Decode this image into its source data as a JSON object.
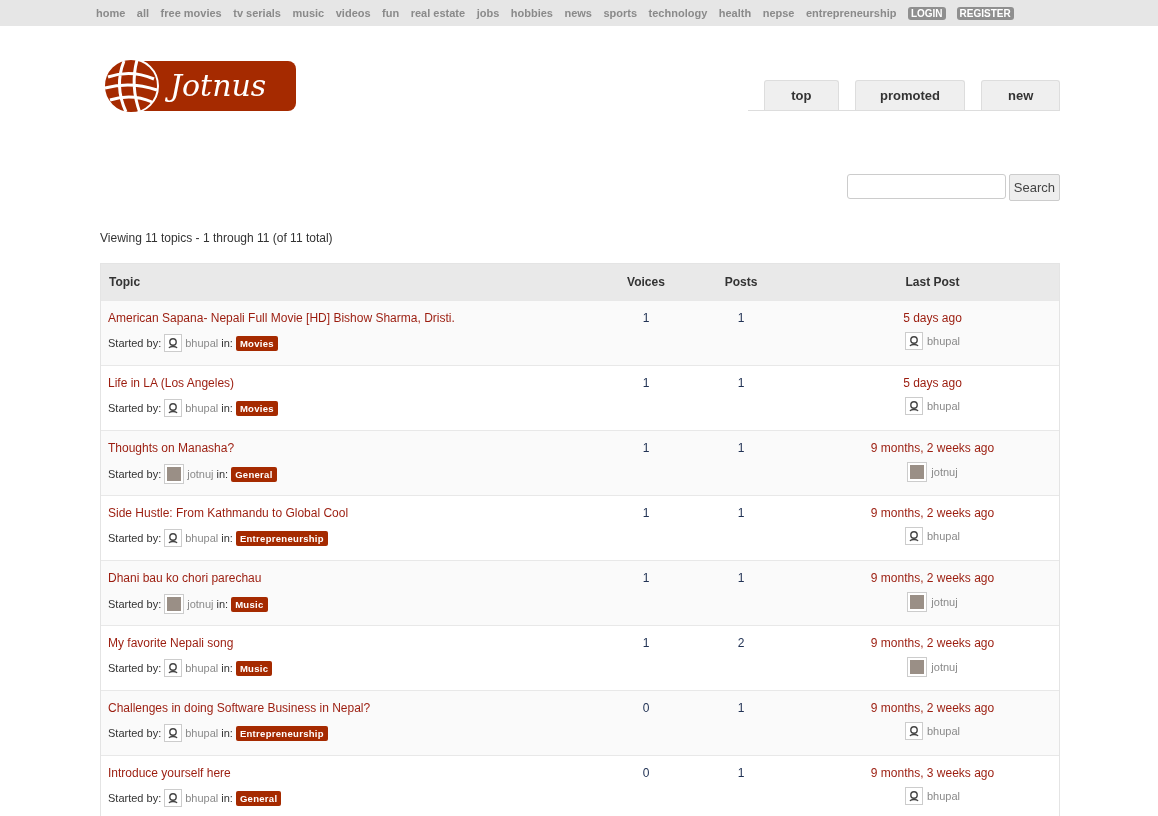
{
  "top_nav": {
    "links": [
      "home",
      "all",
      "free movies",
      "tv serials",
      "music",
      "videos",
      "fun",
      "real estate",
      "jobs",
      "hobbies",
      "news",
      "sports",
      "technology",
      "health",
      "nepse",
      "entrepreneurship"
    ],
    "buttons": [
      "LOGIN",
      "REGISTER"
    ]
  },
  "logo": {
    "text": "Jotnus"
  },
  "tabs": [
    {
      "label": "top"
    },
    {
      "label": "promoted"
    },
    {
      "label": "new"
    }
  ],
  "search": {
    "button": "Search"
  },
  "summary": "Viewing 11 topics - 1 through 11 (of 11 total)",
  "table": {
    "columns": [
      "Topic",
      "Voices",
      "Posts",
      "Last Post"
    ],
    "rows": [
      {
        "title": "American Sapana- Nepali Full Movie [HD] Bishow Sharma, Dristi.",
        "started_label": "Started by:",
        "author": {
          "name": "bhupal",
          "kind": "default"
        },
        "in_label": "in:",
        "forum": "Movies",
        "voices": "1",
        "posts": "1",
        "last_time": "5 days ago",
        "last_user": {
          "name": "bhupal",
          "kind": "default"
        }
      },
      {
        "title": "Life in LA (Los Angeles)",
        "started_label": "Started by:",
        "author": {
          "name": "bhupal",
          "kind": "default"
        },
        "in_label": "in:",
        "forum": "Movies",
        "voices": "1",
        "posts": "1",
        "last_time": "5 days ago",
        "last_user": {
          "name": "bhupal",
          "kind": "default"
        }
      },
      {
        "title": "Thoughts on Manasha?",
        "started_label": "Started by:",
        "author": {
          "name": "jotnuj",
          "kind": "photo"
        },
        "in_label": "in:",
        "forum": "General",
        "voices": "1",
        "posts": "1",
        "last_time": "9 months, 2 weeks ago",
        "last_user": {
          "name": "jotnuj",
          "kind": "photo"
        }
      },
      {
        "title": "Side Hustle: From Kathmandu to Global Cool",
        "started_label": "Started by:",
        "author": {
          "name": "bhupal",
          "kind": "default"
        },
        "in_label": "in:",
        "forum": "Entrepreneurship",
        "voices": "1",
        "posts": "1",
        "last_time": "9 months, 2 weeks ago",
        "last_user": {
          "name": "bhupal",
          "kind": "default"
        }
      },
      {
        "title": "Dhani bau ko chori parechau",
        "started_label": "Started by:",
        "author": {
          "name": "jotnuj",
          "kind": "photo"
        },
        "in_label": "in:",
        "forum": "Music",
        "voices": "1",
        "posts": "1",
        "last_time": "9 months, 2 weeks ago",
        "last_user": {
          "name": "jotnuj",
          "kind": "photo"
        }
      },
      {
        "title": "My favorite Nepali song",
        "started_label": "Started by:",
        "author": {
          "name": "bhupal",
          "kind": "default"
        },
        "in_label": "in:",
        "forum": "Music",
        "voices": "1",
        "posts": "2",
        "last_time": "9 months, 2 weeks ago",
        "last_user": {
          "name": "jotnuj",
          "kind": "photo"
        }
      },
      {
        "title": "Challenges in doing Software Business in Nepal?",
        "started_label": "Started by:",
        "author": {
          "name": "bhupal",
          "kind": "default"
        },
        "in_label": "in:",
        "forum": "Entrepreneurship",
        "voices": "0",
        "posts": "1",
        "last_time": "9 months, 2 weeks ago",
        "last_user": {
          "name": "bhupal",
          "kind": "default"
        }
      },
      {
        "title": "Introduce yourself here",
        "started_label": "Started by:",
        "author": {
          "name": "bhupal",
          "kind": "default"
        },
        "in_label": "in:",
        "forum": "General",
        "voices": "0",
        "posts": "1",
        "last_time": "9 months, 3 weeks ago",
        "last_user": {
          "name": "bhupal",
          "kind": "default"
        }
      }
    ]
  }
}
